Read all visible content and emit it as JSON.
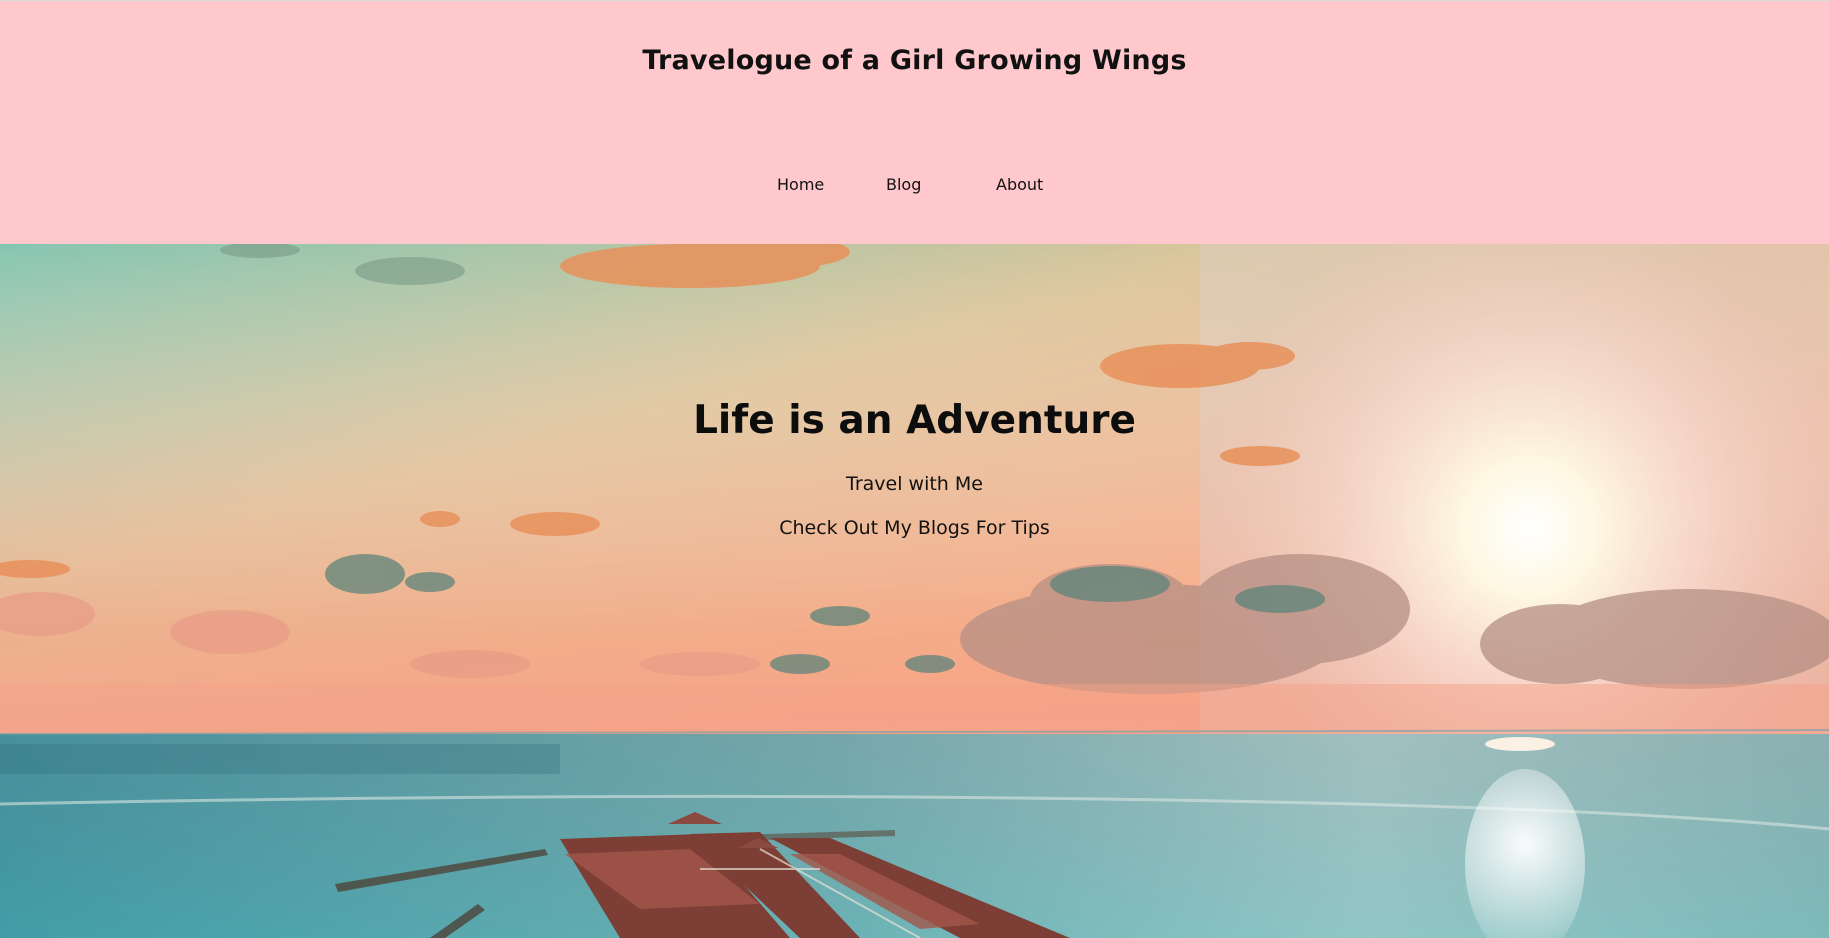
{
  "header": {
    "site_title": "Travelogue of a Girl Growing Wings",
    "nav": {
      "home": "Home",
      "blog": "Blog",
      "about": "About"
    },
    "background_color": "#ffc8cc"
  },
  "hero": {
    "heading": "Life is an Adventure",
    "tagline": "Travel with Me",
    "subtext": "Check Out My Blogs For Tips",
    "image_description_icon": "sunset-over-ocean-resort-photo"
  }
}
